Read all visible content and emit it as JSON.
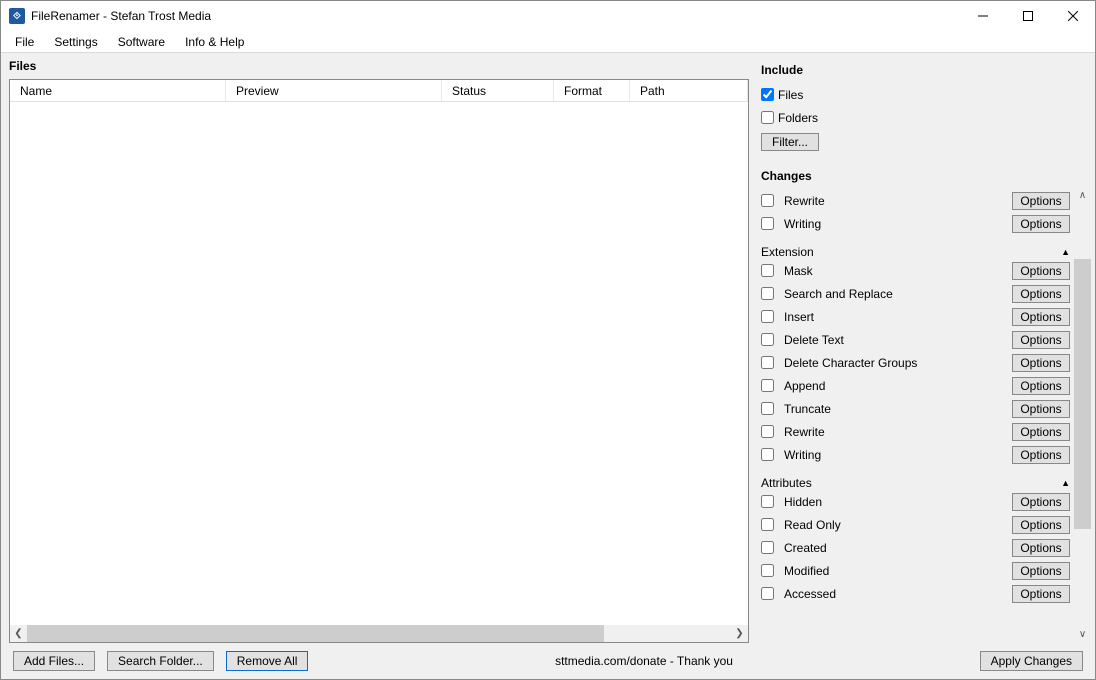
{
  "window": {
    "title": "FileRenamer - Stefan Trost Media"
  },
  "menu": {
    "file": "File",
    "settings": "Settings",
    "software": "Software",
    "infoHelp": "Info & Help"
  },
  "left": {
    "heading": "Files",
    "columns": {
      "name": "Name",
      "preview": "Preview",
      "status": "Status",
      "format": "Format",
      "path": "Path"
    }
  },
  "right": {
    "include": {
      "heading": "Include",
      "files": "Files",
      "folders": "Folders",
      "filter": "Filter..."
    },
    "changes": {
      "heading": "Changes",
      "rewrite": "Rewrite",
      "writing": "Writing",
      "options": "Options"
    },
    "extension": {
      "heading": "Extension",
      "mask": "Mask",
      "searchReplace": "Search and Replace",
      "insert": "Insert",
      "deleteText": "Delete Text",
      "deleteCharGroups": "Delete Character Groups",
      "append": "Append",
      "truncate": "Truncate",
      "rewrite": "Rewrite",
      "writing": "Writing"
    },
    "attributes": {
      "heading": "Attributes",
      "hidden": "Hidden",
      "readOnly": "Read Only",
      "created": "Created",
      "modified": "Modified",
      "accessed": "Accessed"
    }
  },
  "footer": {
    "addFiles": "Add Files...",
    "searchFolder": "Search Folder...",
    "removeAll": "Remove All",
    "statusText": "sttmedia.com/donate - Thank you",
    "applyChanges": "Apply Changes"
  }
}
